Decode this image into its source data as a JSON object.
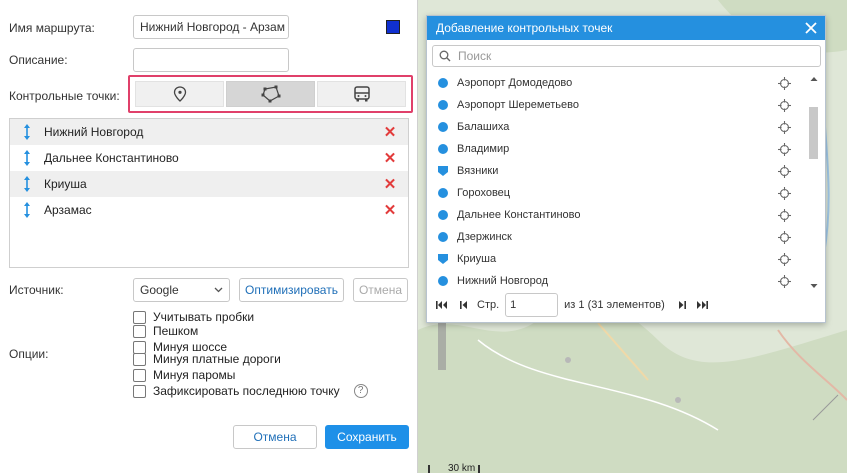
{
  "route_form": {
    "name_label": "Имя маршрута:",
    "name_value": "Нижний Новгород - Арзам",
    "route_color": "#1030d0",
    "description_label": "Описание:",
    "description_value": "",
    "checkpoints_label": "Контрольные точки:",
    "checkpoint_modes": [
      {
        "icon": "map-marker-icon",
        "active": false
      },
      {
        "icon": "polygon-icon",
        "active": true
      },
      {
        "icon": "bus-icon",
        "active": false
      }
    ],
    "waypoints": [
      {
        "name": "Нижний Новгород"
      },
      {
        "name": "Дальнее Константиново"
      },
      {
        "name": "Криуша"
      },
      {
        "name": "Арзамас"
      }
    ],
    "source_label": "Источник:",
    "source_value": "Google",
    "optimize_label": "Оптимизировать",
    "undo_label": "Отмена",
    "options_label": "Опции:",
    "options": [
      {
        "label": "Учитывать пробки",
        "checked": false
      },
      {
        "label": "Пешком",
        "checked": false
      },
      {
        "label": "Минуя шоссе",
        "checked": false
      },
      {
        "label": "Минуя платные дороги",
        "checked": false
      },
      {
        "label": "Минуя паромы",
        "checked": false
      },
      {
        "label": "Зафиксировать последнюю точку",
        "checked": false
      }
    ],
    "help_glyph": "?",
    "cancel_label": "Отмена",
    "save_label": "Сохранить"
  },
  "checkpoint_dialog": {
    "title": "Добавление контрольных точек",
    "search_placeholder": "Поиск",
    "items": [
      {
        "name": "Аэропорт Домодедово",
        "shape": "circle"
      },
      {
        "name": "Аэропорт Шереметьево",
        "shape": "circle"
      },
      {
        "name": "Балашиха",
        "shape": "circle"
      },
      {
        "name": "Владимир",
        "shape": "circle"
      },
      {
        "name": "Вязники",
        "shape": "flag"
      },
      {
        "name": "Гороховец",
        "shape": "circle"
      },
      {
        "name": "Дальнее Константиново",
        "shape": "circle"
      },
      {
        "name": "Дзержинск",
        "shape": "circle"
      },
      {
        "name": "Криуша",
        "shape": "flag"
      },
      {
        "name": "Нижний Новгород",
        "shape": "circle"
      }
    ],
    "pager": {
      "page_label": "Стр.",
      "page_value": "1",
      "of_text": "из 1 (31 элементов)"
    }
  },
  "map": {
    "scale_label": "30 km"
  },
  "colors": {
    "accent": "#2590df",
    "highlight_border": "#e0406a",
    "delete": "#e23b3b"
  }
}
